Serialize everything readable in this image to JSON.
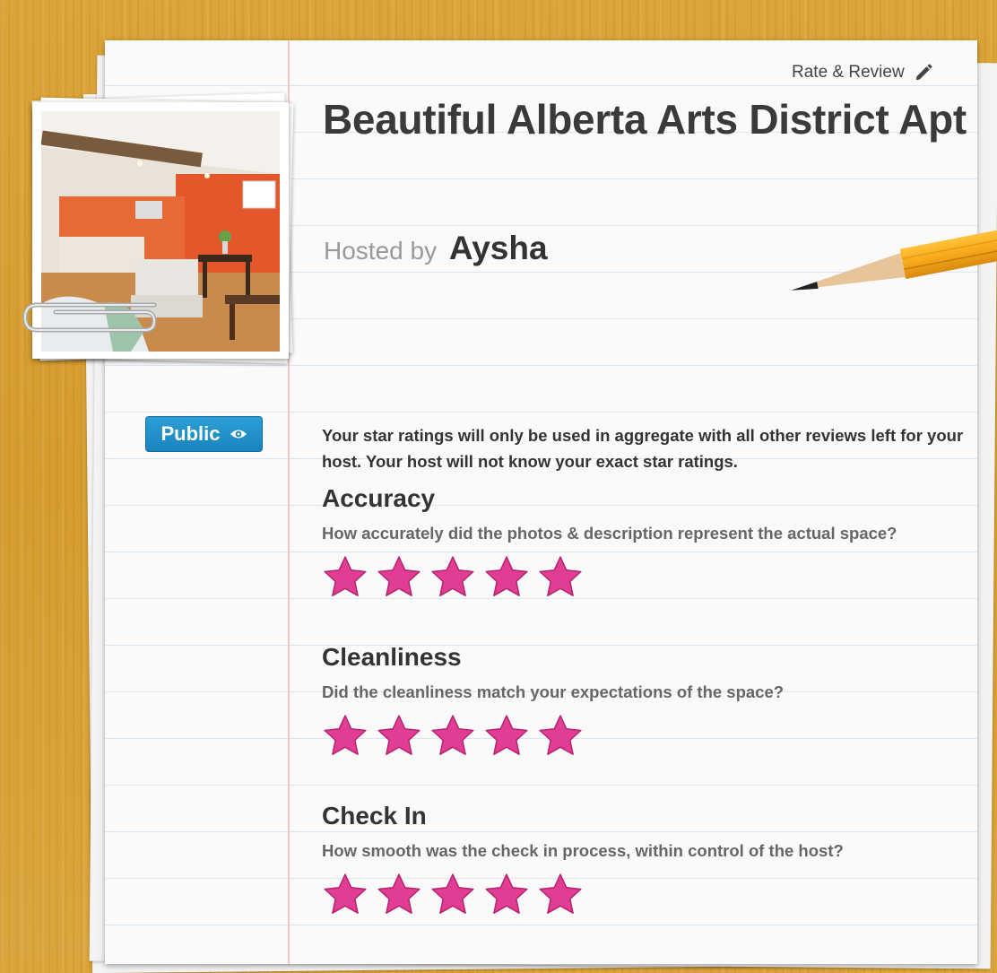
{
  "header": {
    "rate_review_label": "Rate & Review",
    "listing_title": "Beautiful Alberta Arts District Apt",
    "hosted_by_label": "Hosted by",
    "host_name": "Aysha"
  },
  "visibility_badge": {
    "label": "Public",
    "icon": "eye-icon",
    "color": "#2292cf"
  },
  "intro_text": "Your star ratings will only be used in aggregate with all other reviews left for your host. Your host will not know your exact star ratings.",
  "star_color": "#e23d94",
  "sections": [
    {
      "title": "Accuracy",
      "question": "How accurately did the photos & description represent the actual space?",
      "rating": 5,
      "max": 5
    },
    {
      "title": "Cleanliness",
      "question": "Did the cleanliness match your expectations of the space?",
      "rating": 5,
      "max": 5
    },
    {
      "title": "Check In",
      "question": "How smooth was the check in process, within control of the host?",
      "rating": 5,
      "max": 5
    }
  ]
}
